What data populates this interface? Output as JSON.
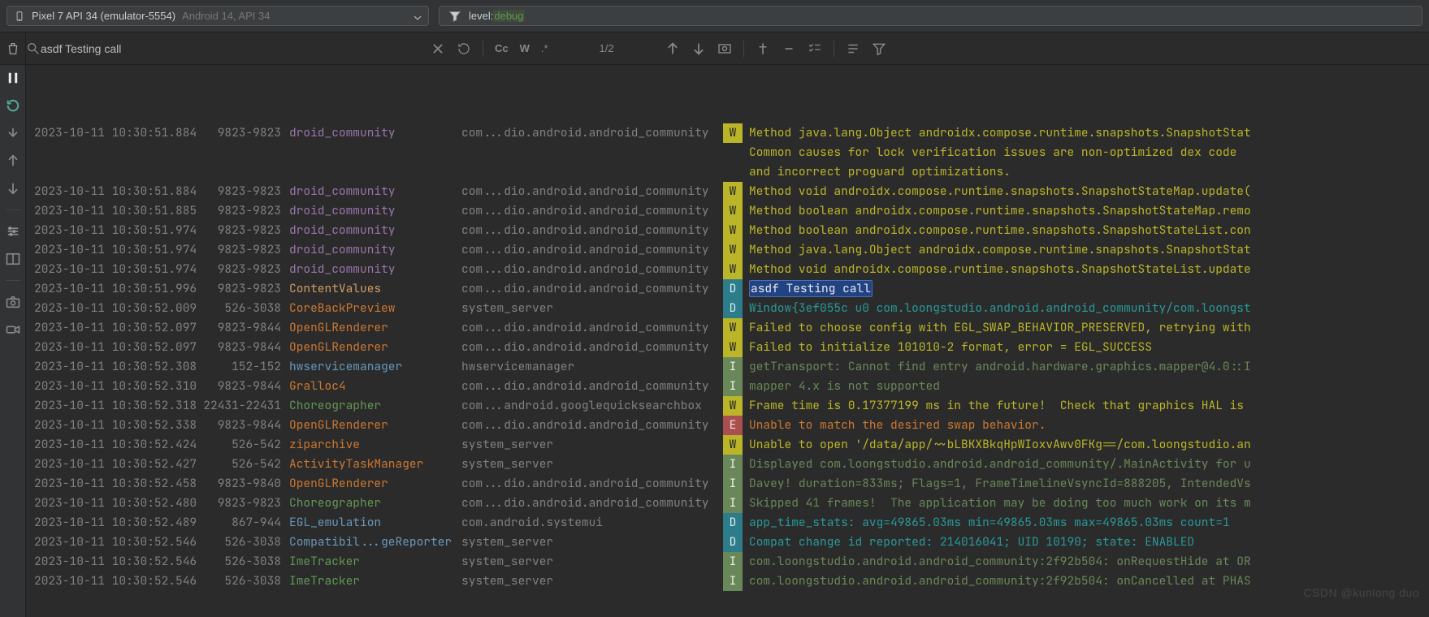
{
  "topbar": {
    "device_main": "Pixel 7 API 34 (emulator-5554)",
    "device_sub": "Android 14, API 34",
    "filter_prefix": "level:",
    "filter_value": "debug"
  },
  "search": {
    "query": "asdf Testing call",
    "match_case": "Cc",
    "words": "W",
    "regex": ".*",
    "count": "1/2"
  },
  "sidebar_icons": [
    "pause",
    "restart",
    "step-down",
    "arrow-up",
    "arrow-down",
    "divider",
    "settings",
    "layout",
    "divider",
    "camera",
    "video"
  ],
  "log": [
    {
      "ts": "2023-10-11 10:30:51.884",
      "pid": "9823-9823",
      "tag": "droid_community",
      "tagClass": "tag-droid",
      "pkg": "com...dio.android.android_community",
      "lvl": "W",
      "msg": "Method java.lang.Object androidx.compose.runtime.snapshots.SnapshotStat"
    },
    {
      "continuation": true,
      "msg": "Common causes for lock verification issues are non-optimized dex code "
    },
    {
      "continuation": true,
      "msg": "and incorrect proguard optimizations."
    },
    {
      "ts": "2023-10-11 10:30:51.884",
      "pid": "9823-9823",
      "tag": "droid_community",
      "tagClass": "tag-droid",
      "pkg": "com...dio.android.android_community",
      "lvl": "W",
      "msg": "Method void androidx.compose.runtime.snapshots.SnapshotStateMap.update("
    },
    {
      "ts": "2023-10-11 10:30:51.885",
      "pid": "9823-9823",
      "tag": "droid_community",
      "tagClass": "tag-droid",
      "pkg": "com...dio.android.android_community",
      "lvl": "W",
      "msg": "Method boolean androidx.compose.runtime.snapshots.SnapshotStateMap.remo"
    },
    {
      "ts": "2023-10-11 10:30:51.974",
      "pid": "9823-9823",
      "tag": "droid_community",
      "tagClass": "tag-droid",
      "pkg": "com...dio.android.android_community",
      "lvl": "W",
      "msg": "Method boolean androidx.compose.runtime.snapshots.SnapshotStateList.con"
    },
    {
      "ts": "2023-10-11 10:30:51.974",
      "pid": "9823-9823",
      "tag": "droid_community",
      "tagClass": "tag-droid",
      "pkg": "com...dio.android.android_community",
      "lvl": "W",
      "msg": "Method java.lang.Object androidx.compose.runtime.snapshots.SnapshotStat"
    },
    {
      "ts": "2023-10-11 10:30:51.974",
      "pid": "9823-9823",
      "tag": "droid_community",
      "tagClass": "tag-droid",
      "pkg": "com...dio.android.android_community",
      "lvl": "W",
      "msg": "Method void androidx.compose.runtime.snapshots.SnapshotStateList.update"
    },
    {
      "ts": "2023-10-11 10:30:51.996",
      "pid": "9823-9823",
      "tag": "ContentValues",
      "tagClass": "tag-content",
      "pkg": "com...dio.android.android_community",
      "lvl": "D",
      "msg": "asdf Testing call",
      "highlight": true
    },
    {
      "ts": "2023-10-11 10:30:52.009",
      "pid": "526-3038",
      "tag": "CoreBackPreview",
      "tagClass": "tag-core",
      "pkg": "system_server",
      "lvl": "D",
      "msg": "Window{3ef055c u0 com.loongstudio.android.android_community/com.loongst"
    },
    {
      "ts": "2023-10-11 10:30:52.097",
      "pid": "9823-9844",
      "tag": "OpenGLRenderer",
      "tagClass": "tag-opengl",
      "pkg": "com...dio.android.android_community",
      "lvl": "W",
      "msg": "Failed to choose config with EGL_SWAP_BEHAVIOR_PRESERVED, retrying with"
    },
    {
      "ts": "2023-10-11 10:30:52.097",
      "pid": "9823-9844",
      "tag": "OpenGLRenderer",
      "tagClass": "tag-opengl",
      "pkg": "com...dio.android.android_community",
      "lvl": "W",
      "msg": "Failed to initialize 101010-2 format, error = EGL_SUCCESS"
    },
    {
      "ts": "2023-10-11 10:30:52.308",
      "pid": "152-152",
      "tag": "hwservicemanager",
      "tagClass": "tag-hw",
      "pkg": "hwservicemanager",
      "lvl": "I",
      "msg": "getTransport: Cannot find entry android.hardware.graphics.mapper@4.0::I"
    },
    {
      "ts": "2023-10-11 10:30:52.310",
      "pid": "9823-9844",
      "tag": "Gralloc4",
      "tagClass": "tag-gralloc",
      "pkg": "com...dio.android.android_community",
      "lvl": "I",
      "msg": "mapper 4.x is not supported"
    },
    {
      "ts": "2023-10-11 10:30:52.318",
      "pid": "22431-22431",
      "tag": "Choreographer",
      "tagClass": "tag-choreo",
      "pkg": "com...android.googlequicksearchbox",
      "lvl": "W",
      "msg": "Frame time is 0.17377199 ms in the future!  Check that graphics HAL is "
    },
    {
      "ts": "2023-10-11 10:30:52.338",
      "pid": "9823-9844",
      "tag": "OpenGLRenderer",
      "tagClass": "tag-opengl",
      "pkg": "com...dio.android.android_community",
      "lvl": "E",
      "msg": "Unable to match the desired swap behavior."
    },
    {
      "ts": "2023-10-11 10:30:52.424",
      "pid": "526-542",
      "tag": "ziparchive",
      "tagClass": "tag-zip",
      "pkg": "system_server",
      "lvl": "W",
      "msg": "Unable to open '/data/app/~~bLBKXBkqHpWIoxvAwv0FKg==/com.loongstudio.an"
    },
    {
      "ts": "2023-10-11 10:30:52.427",
      "pid": "526-542",
      "tag": "ActivityTaskManager",
      "tagClass": "tag-atm",
      "pkg": "system_server",
      "lvl": "I",
      "msg": "Displayed com.loongstudio.android.android_community/.MainActivity for u"
    },
    {
      "ts": "2023-10-11 10:30:52.458",
      "pid": "9823-9840",
      "tag": "OpenGLRenderer",
      "tagClass": "tag-opengl",
      "pkg": "com...dio.android.android_community",
      "lvl": "I",
      "msg": "Davey! duration=833ms; Flags=1, FrameTimelineVsyncId=888205, IntendedVs"
    },
    {
      "ts": "2023-10-11 10:30:52.480",
      "pid": "9823-9823",
      "tag": "Choreographer",
      "tagClass": "tag-choreo",
      "pkg": "com...dio.android.android_community",
      "lvl": "I",
      "msg": "Skipped 41 frames!  The application may be doing too much work on its m"
    },
    {
      "ts": "2023-10-11 10:30:52.489",
      "pid": "867-944",
      "tag": "EGL_emulation",
      "tagClass": "tag-egl",
      "pkg": "com.android.systemui",
      "lvl": "D",
      "msg": "app_time_stats: avg=49865.03ms min=49865.03ms max=49865.03ms count=1"
    },
    {
      "ts": "2023-10-11 10:30:52.546",
      "pid": "526-3038",
      "tag": "Compatibil...geReporter",
      "tagClass": "tag-compat",
      "pkg": "system_server",
      "lvl": "D",
      "msg": "Compat change id reported: 214016041; UID 10190; state: ENABLED"
    },
    {
      "ts": "2023-10-11 10:30:52.546",
      "pid": "526-3038",
      "tag": "ImeTracker",
      "tagClass": "tag-ime",
      "pkg": "system_server",
      "lvl": "I",
      "msg": "com.loongstudio.android.android_community:2f92b504: onRequestHide at OR"
    },
    {
      "ts": "2023-10-11 10:30:52.546",
      "pid": "526-3038",
      "tag": "ImeTracker",
      "tagClass": "tag-ime",
      "pkg": "system_server",
      "lvl": "I",
      "msg": "com.loongstudio.android.android_community:2f92b504: onCancelled at PHAS"
    }
  ],
  "watermark": "CSDN @kunlong duo"
}
